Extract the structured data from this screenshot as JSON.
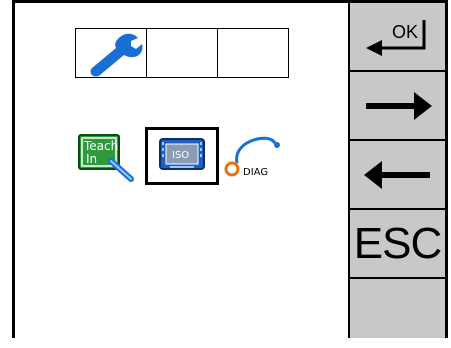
{
  "softkeys": [
    {
      "id": "ok",
      "label": "OK",
      "icon": "enter-ok-icon"
    },
    {
      "id": "right",
      "label": "",
      "icon": "arrow-right-icon"
    },
    {
      "id": "left",
      "label": "",
      "icon": "arrow-left-icon"
    },
    {
      "id": "esc",
      "label": "ESC",
      "icon": ""
    },
    {
      "id": "empty",
      "label": "",
      "icon": ""
    }
  ],
  "menu": {
    "row1": [
      {
        "icon": "wrench-icon",
        "label": ""
      },
      {
        "icon": "",
        "label": ""
      },
      {
        "icon": "",
        "label": ""
      }
    ],
    "row2": [
      {
        "icon": "teach-in-icon",
        "text_line1": "Teach",
        "text_line2": "In"
      },
      {
        "icon": "iso-terminal-icon",
        "text": "ISO",
        "selected": true
      },
      {
        "icon": "diag-stethoscope-icon",
        "text": "DIAG"
      }
    ]
  },
  "colors": {
    "softkey_bg": "#c8c8c8",
    "wrench_blue": "#1a6fd4",
    "teach_green": "#2e9a3a",
    "iso_blue": "#1f5fbf",
    "diag_orange": "#e8720c"
  }
}
